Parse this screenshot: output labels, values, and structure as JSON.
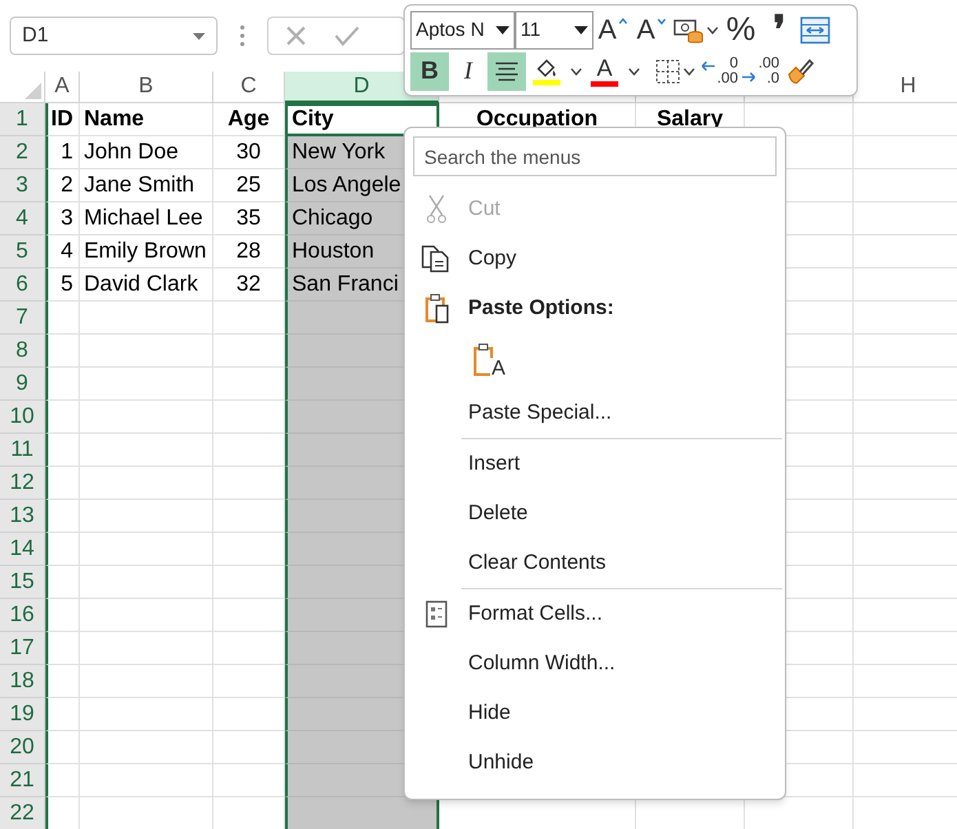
{
  "name_box": {
    "value": "D1"
  },
  "formula_buttons": [
    {
      "kind": "cancel",
      "disabled": true
    },
    {
      "kind": "enter",
      "disabled": true
    }
  ],
  "columns": [
    {
      "label": "A",
      "selected": false
    },
    {
      "label": "B",
      "selected": false
    },
    {
      "label": "C",
      "selected": false
    },
    {
      "label": "D",
      "selected": true
    },
    {
      "selected": false
    },
    {
      "selected": false
    },
    {
      "selected": false
    },
    {
      "label": "H",
      "selected": false
    }
  ],
  "rows": [
    {
      "number": "1",
      "kind": "header",
      "cells": [
        "ID",
        "Name",
        "Age",
        "City",
        "Occupation",
        "Salary"
      ]
    },
    {
      "number": "2",
      "kind": "data",
      "cells": [
        "1",
        "John Doe",
        "30",
        "New York"
      ]
    },
    {
      "number": "3",
      "kind": "data",
      "cells": [
        "2",
        "Jane Smith",
        "25",
        "Los Angele"
      ]
    },
    {
      "number": "4",
      "kind": "data",
      "cells": [
        "3",
        "Michael Lee",
        "35",
        "Chicago"
      ]
    },
    {
      "number": "5",
      "kind": "data",
      "cells": [
        "4",
        "Emily Brown",
        "28",
        "Houston"
      ]
    },
    {
      "number": "6",
      "kind": "data",
      "cells": [
        "5",
        "David Clark",
        "32",
        "San Franci"
      ]
    },
    {
      "number": "7",
      "kind": "data",
      "cells": []
    },
    {
      "number": "8",
      "kind": "data",
      "cells": []
    },
    {
      "number": "9",
      "kind": "data",
      "cells": []
    },
    {
      "number": "10",
      "kind": "data",
      "cells": []
    },
    {
      "number": "11",
      "kind": "data",
      "cells": []
    },
    {
      "number": "12",
      "kind": "data",
      "cells": []
    },
    {
      "number": "13",
      "kind": "data",
      "cells": []
    },
    {
      "number": "14",
      "kind": "data",
      "cells": []
    },
    {
      "number": "15",
      "kind": "data",
      "cells": []
    },
    {
      "number": "16",
      "kind": "data",
      "cells": []
    },
    {
      "number": "17",
      "kind": "data",
      "cells": []
    },
    {
      "number": "18",
      "kind": "data",
      "cells": []
    },
    {
      "number": "19",
      "kind": "data",
      "cells": []
    },
    {
      "number": "20",
      "kind": "data",
      "cells": []
    },
    {
      "number": "21",
      "kind": "data",
      "cells": []
    },
    {
      "number": "22",
      "kind": "data",
      "cells": []
    }
  ],
  "mini_toolbar": {
    "font": {
      "value": "Aptos N"
    },
    "size": {
      "value": "11"
    },
    "row_1": [
      {
        "kind": "grow-font",
        "glyph": "A"
      },
      {
        "kind": "shrink-font",
        "glyph": "A"
      },
      {
        "kind": "number-format"
      },
      {
        "kind": "caret"
      },
      {
        "kind": "percent",
        "glyph": "%"
      },
      {
        "kind": "comma",
        "glyph": "❜"
      },
      {
        "kind": "wrap"
      }
    ],
    "row_2": [
      {
        "kind": "bold",
        "glyph": "B",
        "selected": true
      },
      {
        "kind": "italic",
        "glyph": "I",
        "selected": false
      },
      {
        "kind": "center",
        "selected": true
      },
      {
        "kind": "fill-color",
        "color": "#ffff00"
      },
      {
        "kind": "caret"
      },
      {
        "kind": "font-color",
        "glyph": "A",
        "color": "#ff0000"
      },
      {
        "kind": "caret"
      },
      {
        "kind": "borders"
      },
      {
        "kind": "caret"
      },
      {
        "kind": "increase-decimal",
        "lines": [
          "0",
          ".00"
        ]
      },
      {
        "kind": "decrease-decimal",
        "lines": [
          ".00",
          ".0"
        ]
      },
      {
        "kind": "format-painter"
      }
    ]
  },
  "context_menu": {
    "search": {
      "placeholder": "Search the menus"
    },
    "items": [
      {
        "kind": "cut",
        "label": "Cut",
        "disabled": true
      },
      {
        "kind": "copy",
        "label": "Copy",
        "disabled": false
      },
      {
        "kind": "paste-options",
        "label": "Paste Options:"
      },
      {
        "kind": "paste-button",
        "glyph": "A"
      },
      {
        "kind": "command",
        "label": "Paste Special...",
        "disabled": false
      },
      {
        "kind": "separator"
      },
      {
        "kind": "command",
        "label": "Insert",
        "disabled": false
      },
      {
        "kind": "command",
        "label": "Delete",
        "disabled": false
      },
      {
        "kind": "command",
        "label": "Clear Contents",
        "disabled": false
      },
      {
        "kind": "separator"
      },
      {
        "kind": "format-cells",
        "label": "Format Cells...",
        "disabled": false
      },
      {
        "kind": "command",
        "label": "Column Width...",
        "disabled": false
      },
      {
        "kind": "command",
        "label": "Hide",
        "disabled": false
      },
      {
        "kind": "command",
        "label": "Unhide",
        "disabled": false
      }
    ]
  }
}
